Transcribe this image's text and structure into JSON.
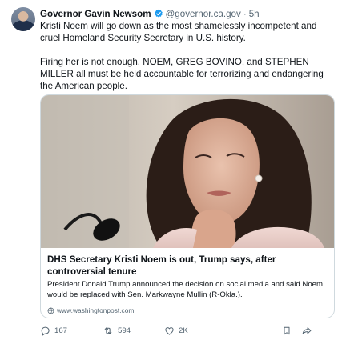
{
  "post": {
    "author_name": "Governor Gavin Newsom",
    "handle": "@governor.ca.gov",
    "separator": "·",
    "time": "5h",
    "paragraphs": [
      "Kristi Noem will go down as the most shamelessly incompetent and cruel Homeland Security Secretary in U.S. history.",
      "Firing her is not enough. NOEM, GREG BOVINO, and STEPHEN MILLER all must be held accountable for terrorizing and endangering the American people."
    ]
  },
  "card": {
    "title": "DHS Secretary Kristi Noem is out, Trump says, after controversial tenure",
    "description": "President Donald Trump announced the decision on social media and said Noem would be replaced with Sen. Markwayne Mullin (R-Okla.).",
    "source": "www.washingtonpost.com"
  },
  "actions": {
    "replies": "167",
    "reposts": "594",
    "likes": "2K"
  },
  "colors": {
    "verified": "#1d9bf0",
    "muted": "#536471",
    "text": "#0f1419",
    "border": "#cfd9de"
  },
  "icons": [
    "verified-badge-icon",
    "reply-icon",
    "repost-icon",
    "like-icon",
    "bookmark-icon",
    "share-icon",
    "globe-icon"
  ]
}
